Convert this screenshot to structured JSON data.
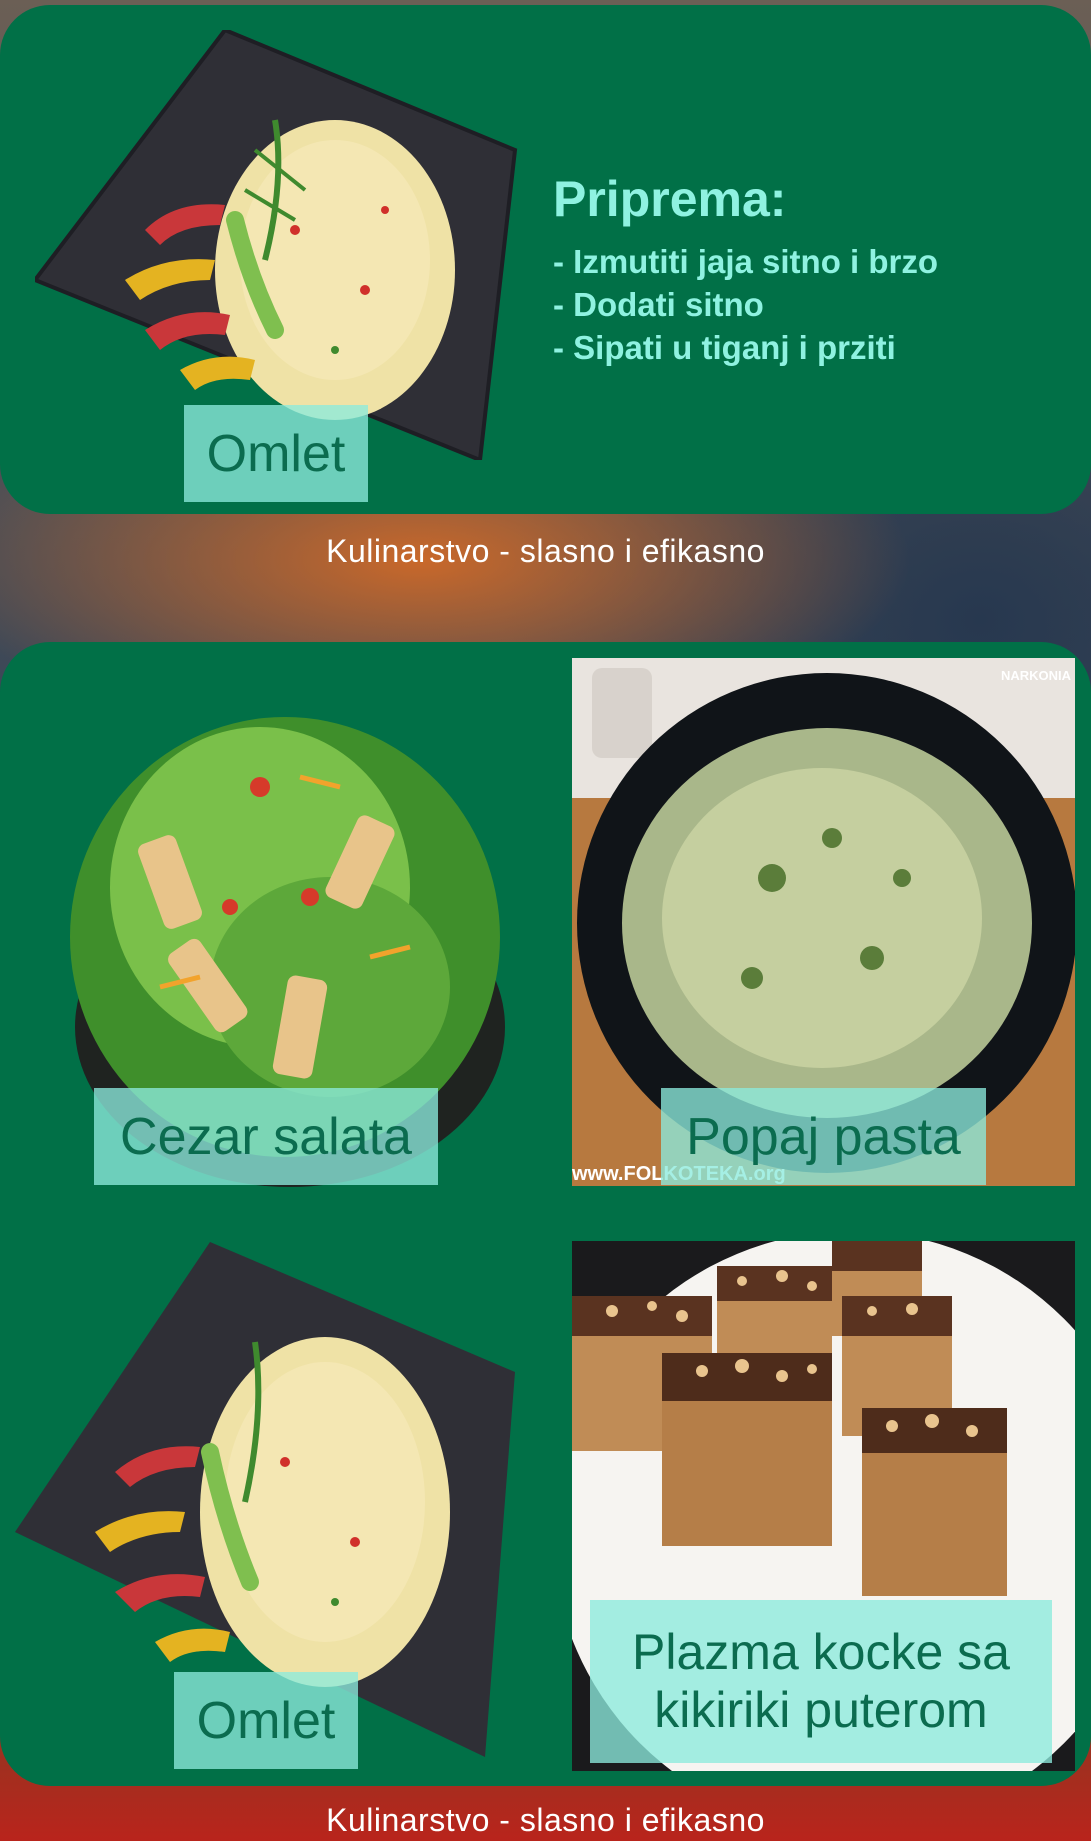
{
  "top_card": {
    "dish_label": "Omlet",
    "recipe_title": "Priprema:",
    "steps": [
      "- Izmutiti jaja sitno i brzo",
      "- Dodati sitno",
      "- Sipati u tiganj i prziti"
    ]
  },
  "footer_top": "Kulinarstvo - slasno i efikasno",
  "grid": [
    {
      "label": "Cezar salata",
      "image": "caesar-salad-photo"
    },
    {
      "label": "Popaj pasta",
      "image": "spinach-pasta-photo",
      "watermark": "www.FOLKOTEKA.org",
      "corner_mark": "NARKONIA"
    },
    {
      "label": "Omlet",
      "image": "omelet-photo"
    },
    {
      "label": "Plazma kocke sa kikiriki puterom",
      "image": "peanut-butter-cubes-photo"
    }
  ],
  "footer_bottom": "Kulinarstvo - slasno i efikasno",
  "colors": {
    "card_green": "#017047",
    "label_bg": "#8cebdc",
    "label_text": "#0b6c4f",
    "recipe_text": "#8ff2e1"
  }
}
